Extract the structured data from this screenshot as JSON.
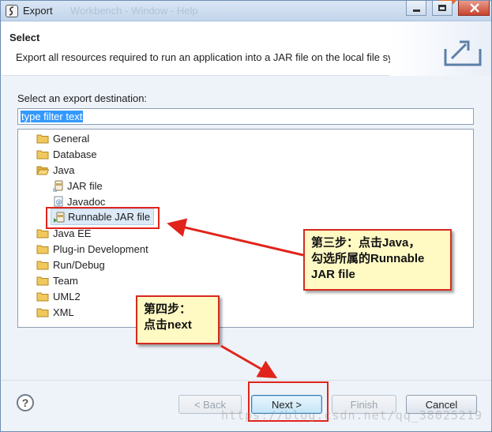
{
  "window": {
    "title": "Export",
    "background_title": "Workbench - Window - Help"
  },
  "header": {
    "title": "Select",
    "description": "Export all resources required to run an application into a JAR file on the local file system."
  },
  "content": {
    "destination_label": "Select an export destination:",
    "filter_value": "type filter text"
  },
  "tree": {
    "items": [
      {
        "label": "General",
        "icon": "folder-icon"
      },
      {
        "label": "Database",
        "icon": "folder-icon"
      },
      {
        "label": "Java",
        "icon": "folder-open-icon"
      },
      {
        "label": "JAR file",
        "icon": "jar-file-icon"
      },
      {
        "label": "Javadoc",
        "icon": "javadoc-icon"
      },
      {
        "label": "Runnable JAR file",
        "icon": "runnable-jar-icon",
        "selected": true
      },
      {
        "label": "Java EE",
        "icon": "folder-icon"
      },
      {
        "label": "Plug-in Development",
        "icon": "folder-icon"
      },
      {
        "label": "Run/Debug",
        "icon": "folder-icon"
      },
      {
        "label": "Team",
        "icon": "folder-icon"
      },
      {
        "label": "UML2",
        "icon": "folder-icon"
      },
      {
        "label": "XML",
        "icon": "folder-icon"
      }
    ]
  },
  "annotations": {
    "step3_line1": "第三步：点击Java，",
    "step3_line2": "勾选所属的Runnable",
    "step3_line3": "JAR file",
    "step4_line1": "第四步：",
    "step4_line2": "点击next"
  },
  "buttons": {
    "help": "?",
    "back": "< Back",
    "next": "Next >",
    "finish": "Finish",
    "cancel": "Cancel"
  },
  "watermark": "https://blog.csdn.net/qq_38025219",
  "colors": {
    "annotation_red": "#e0241b",
    "callout_fill": "#fff9c4",
    "selection": "#3399ff",
    "folder": "#e8b84a"
  }
}
